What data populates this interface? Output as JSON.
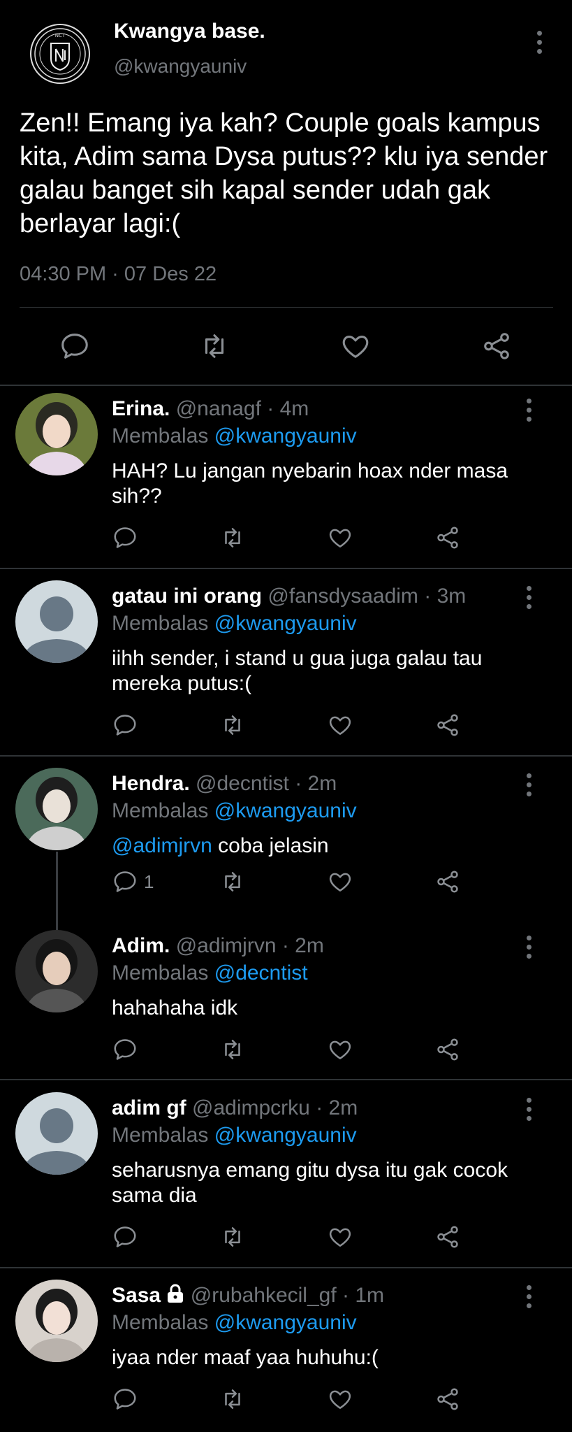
{
  "tweet": {
    "author_name": "Kwangya base.",
    "author_handle": "@kwangyauniv",
    "logo_text": "NCT",
    "text": "Zen!! Emang iya kah? Couple goals kampus kita, Adim sama Dysa putus?? klu iya sender galau banget sih kapal sender udah gak berlayar lagi:(",
    "timestamp": "04:30 PM · 07 Des 22"
  },
  "replies": [
    {
      "name": "Erina.",
      "meta": "@nanagf · 4m",
      "replying_label": "Membalas",
      "replying_to": "@kwangyauniv",
      "text": "HAH? Lu jangan nyebarin hoax nder masa sih??",
      "reply_count": ""
    },
    {
      "name": "gatau ini orang",
      "meta": "@fansdysaadim · 3m",
      "replying_label": "Membalas",
      "replying_to": "@kwangyauniv",
      "text": "iihh sender, i stand u gua juga galau tau mereka putus:(",
      "reply_count": ""
    },
    {
      "name": "Hendra.",
      "meta": "@decntist · 2m",
      "replying_label": "Membalas",
      "replying_to": "@kwangyauniv",
      "mention": "@adimjrvn",
      "text": " coba jelasin",
      "reply_count": "1"
    },
    {
      "name": "Adim.",
      "meta": "@adimjrvn · 2m",
      "replying_label": "Membalas",
      "replying_to": "@decntist",
      "text": "hahahaha idk",
      "reply_count": ""
    },
    {
      "name": "adim gf",
      "meta": "@adimpcrku · 2m",
      "replying_label": "Membalas",
      "replying_to": "@kwangyauniv",
      "text": "seharusnya emang gitu dysa itu gak cocok sama dia",
      "reply_count": ""
    },
    {
      "name": "Sasa",
      "meta": "@rubahkecil_gf · 1m",
      "replying_label": "Membalas",
      "replying_to": "@kwangyauniv",
      "text": "iyaa nder maaf yaa huhuhu:(",
      "reply_count": ""
    }
  ],
  "colors": {
    "background": "#000000",
    "link": "#1d9bf0",
    "muted": "#72767b",
    "divider": "#2f3336"
  }
}
